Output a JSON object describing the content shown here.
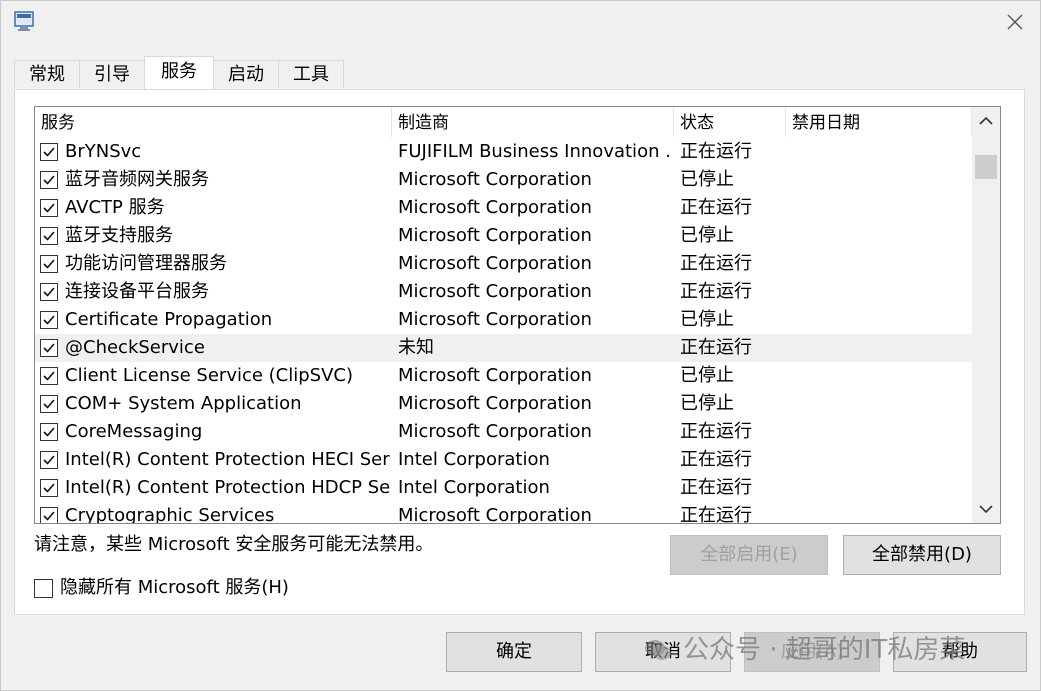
{
  "window": {
    "title_icon": "msconfig-app-icon",
    "close_icon": "close-icon"
  },
  "tabs": [
    {
      "label": "常规",
      "active": false
    },
    {
      "label": "引导",
      "active": false
    },
    {
      "label": "服务",
      "active": true
    },
    {
      "label": "启动",
      "active": false
    },
    {
      "label": "工具",
      "active": false
    }
  ],
  "services_table": {
    "columns": [
      "服务",
      "制造商",
      "状态",
      "禁用日期"
    ],
    "rows": [
      {
        "checked": true,
        "service": "BrYNSvc",
        "manufacturer": "FUJIFILM Business Innovation ...",
        "status": "正在运行",
        "disabled_date": ""
      },
      {
        "checked": true,
        "service": "蓝牙音频网关服务",
        "manufacturer": "Microsoft Corporation",
        "status": "已停止",
        "disabled_date": ""
      },
      {
        "checked": true,
        "service": "AVCTP 服务",
        "manufacturer": "Microsoft Corporation",
        "status": "正在运行",
        "disabled_date": ""
      },
      {
        "checked": true,
        "service": "蓝牙支持服务",
        "manufacturer": "Microsoft Corporation",
        "status": "已停止",
        "disabled_date": ""
      },
      {
        "checked": true,
        "service": "功能访问管理器服务",
        "manufacturer": "Microsoft Corporation",
        "status": "正在运行",
        "disabled_date": ""
      },
      {
        "checked": true,
        "service": "连接设备平台服务",
        "manufacturer": "Microsoft Corporation",
        "status": "正在运行",
        "disabled_date": ""
      },
      {
        "checked": true,
        "service": "Certificate Propagation",
        "manufacturer": "Microsoft Corporation",
        "status": "已停止",
        "disabled_date": ""
      },
      {
        "checked": true,
        "service": "@CheckService",
        "manufacturer": "未知",
        "status": "正在运行",
        "disabled_date": "",
        "highlighted": true
      },
      {
        "checked": true,
        "service": "Client License Service (ClipSVC)",
        "manufacturer": "Microsoft Corporation",
        "status": "已停止",
        "disabled_date": ""
      },
      {
        "checked": true,
        "service": "COM+ System Application",
        "manufacturer": "Microsoft Corporation",
        "status": "已停止",
        "disabled_date": ""
      },
      {
        "checked": true,
        "service": "CoreMessaging",
        "manufacturer": "Microsoft Corporation",
        "status": "正在运行",
        "disabled_date": ""
      },
      {
        "checked": true,
        "service": "Intel(R) Content Protection HECI Ser...",
        "manufacturer": "Intel Corporation",
        "status": "正在运行",
        "disabled_date": ""
      },
      {
        "checked": true,
        "service": "Intel(R) Content Protection HDCP Se...",
        "manufacturer": "Intel Corporation",
        "status": "正在运行",
        "disabled_date": ""
      },
      {
        "checked": true,
        "service": "Cryptographic Services",
        "manufacturer": "Microsoft Corporation",
        "status": "正在运行",
        "disabled_date": ""
      }
    ]
  },
  "note": "请注意，某些 Microsoft 安全服务可能无法禁用。",
  "buttons": {
    "enable_all": "全部启用(E)",
    "disable_all": "全部禁用(D)",
    "ok": "确定",
    "cancel": "取消",
    "apply": "应用(A)",
    "help": "帮助"
  },
  "hide_ms_services": {
    "label": "隐藏所有 Microsoft 服务(H)",
    "checked": false
  },
  "watermark": "公众号 · 超哥的IT私房菜",
  "colors": {
    "highlight_row": "#f0f0f0",
    "disabled_button": "#cccccc",
    "button": "#e1e1e1"
  }
}
